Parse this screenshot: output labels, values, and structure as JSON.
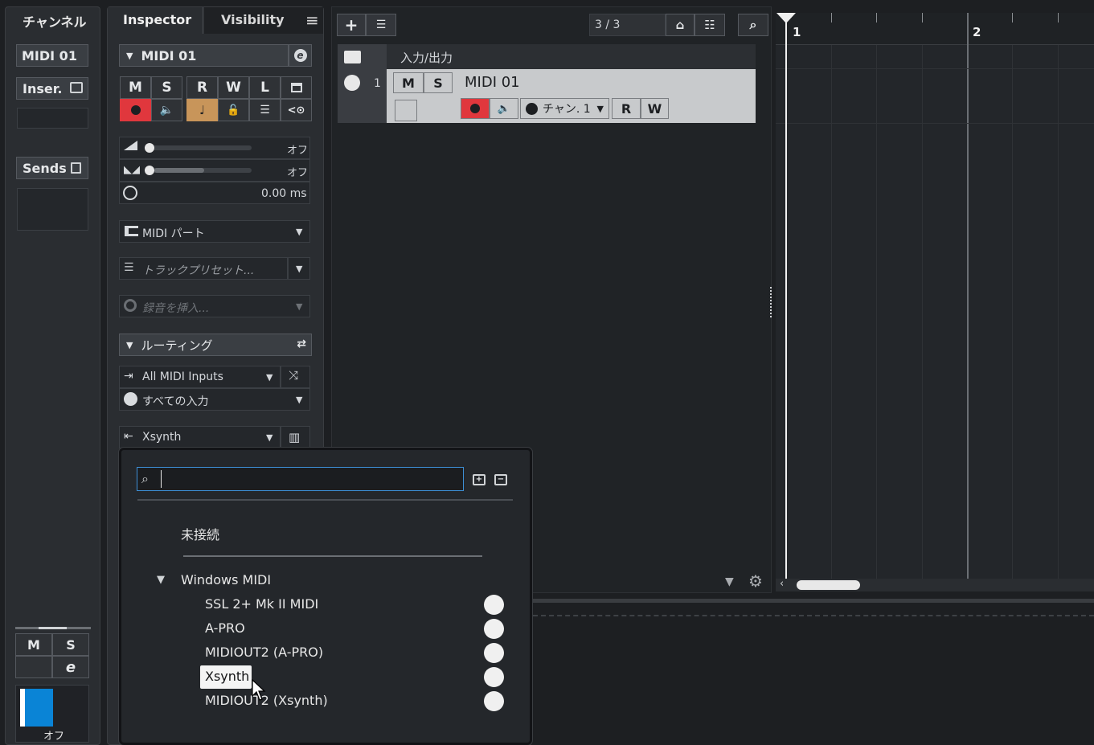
{
  "channel_panel": {
    "header": "チャンネル",
    "track_name": "MIDI 01",
    "inserts_label": "Inser.",
    "sends_label": "Sends",
    "mute": "M",
    "solo": "S",
    "fader_value": "オフ"
  },
  "inspector": {
    "tabs": [
      "Inspector",
      "Visibility"
    ],
    "track_name": "MIDI 01",
    "buttons_row1": [
      "M",
      "S",
      "R",
      "W",
      "L"
    ],
    "volume_value": "オフ",
    "pan_value": "オフ",
    "delay_value": "0.00 ms",
    "part_selector": "MIDI パート",
    "preset_placeholder": "トラックプリセット...",
    "record_insert_placeholder": "録音を挿入...",
    "routing_header": "ルーティング",
    "midi_input": "All MIDI Inputs",
    "input_channel": "すべての入力",
    "midi_output": "Xsynth"
  },
  "project": {
    "track_count": "3 / 3",
    "folder_label": "入力/出力",
    "track": {
      "number": "1",
      "name": "MIDI 01",
      "mute": "M",
      "solo": "S",
      "channel": "チャン. 1",
      "read": "R",
      "write": "W"
    },
    "ruler": [
      "1",
      "2"
    ]
  },
  "dropdown": {
    "search_value": "",
    "disconnected": "未接続",
    "group": "Windows MIDI",
    "items": [
      "SSL 2+ Mk II MIDI",
      "A-PRO",
      "MIDIOUT2 (A-PRO)",
      "Xsynth",
      "MIDIOUT2 (Xsynth)"
    ],
    "selected_index": 3
  },
  "colors": {
    "record_red": "#e0373d",
    "accent_blue": "#0a84d6",
    "monitor_orange": "#c8955a"
  }
}
